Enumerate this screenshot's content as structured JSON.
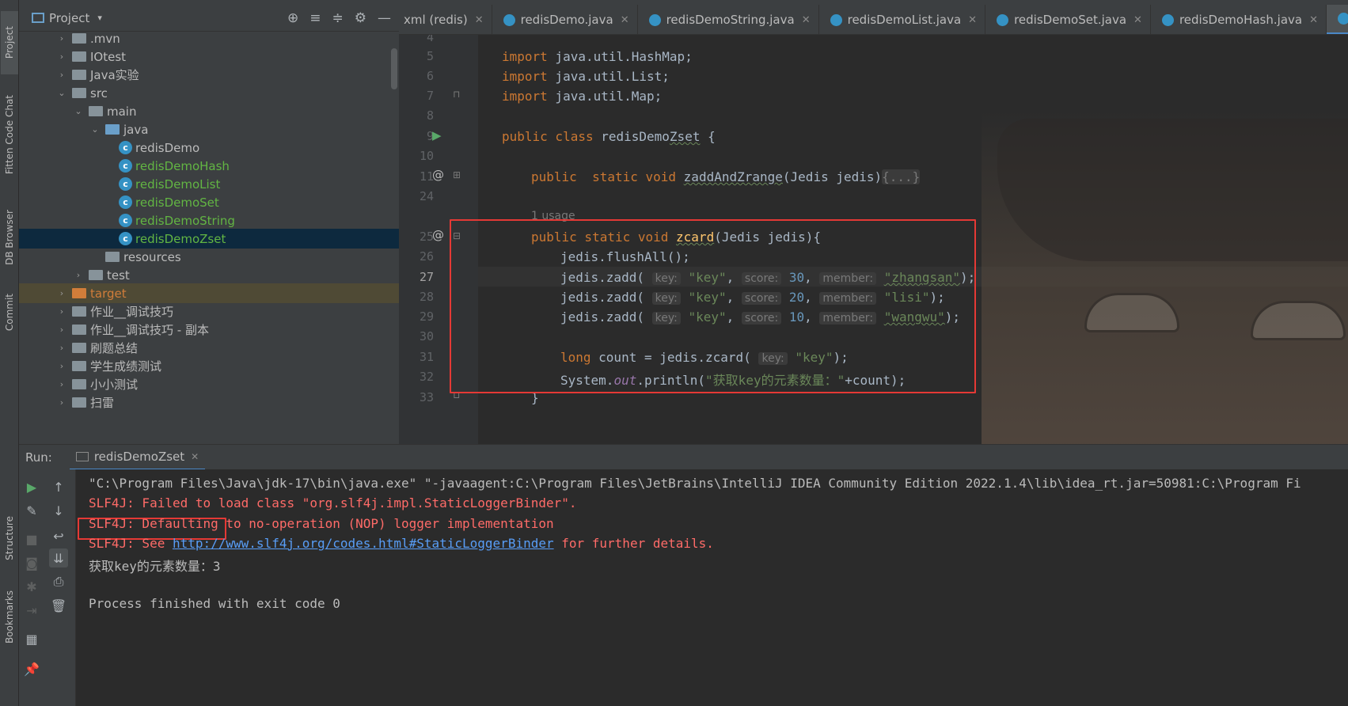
{
  "sidebar_left": {
    "tabs": [
      "Project",
      "Fitten Code Chat",
      "DB Browser",
      "Commit",
      "Structure",
      "Bookmarks"
    ]
  },
  "project_panel": {
    "title": "Project",
    "tree": [
      {
        "label": ".mvn",
        "depth": 3,
        "type": "folder",
        "arrow": "›"
      },
      {
        "label": "IOtest",
        "depth": 3,
        "type": "folder",
        "arrow": "›"
      },
      {
        "label": "Java实验",
        "depth": 3,
        "type": "folder",
        "arrow": "›"
      },
      {
        "label": "src",
        "depth": 3,
        "type": "folder",
        "arrow": "⌄"
      },
      {
        "label": "main",
        "depth": 4,
        "type": "folder",
        "arrow": "⌄"
      },
      {
        "label": "java",
        "depth": 5,
        "type": "folder-blue",
        "arrow": "⌄"
      },
      {
        "label": "redisDemo",
        "depth": 6,
        "type": "class"
      },
      {
        "label": "redisDemoHash",
        "depth": 6,
        "type": "class-green"
      },
      {
        "label": "redisDemoList",
        "depth": 6,
        "type": "class-green"
      },
      {
        "label": "redisDemoSet",
        "depth": 6,
        "type": "class-green"
      },
      {
        "label": "redisDemoString",
        "depth": 6,
        "type": "class-green"
      },
      {
        "label": "redisDemoZset",
        "depth": 6,
        "type": "class-green",
        "selected": true
      },
      {
        "label": "resources",
        "depth": 5,
        "type": "folder"
      },
      {
        "label": "test",
        "depth": 4,
        "type": "folder",
        "arrow": "›"
      },
      {
        "label": "target",
        "depth": 3,
        "type": "folder-orange",
        "arrow": "›",
        "target": true
      },
      {
        "label": "作业__调试技巧",
        "depth": 3,
        "type": "folder",
        "arrow": "›"
      },
      {
        "label": "作业__调试技巧 - 副本",
        "depth": 3,
        "type": "folder",
        "arrow": "›"
      },
      {
        "label": "刷题总结",
        "depth": 3,
        "type": "folder",
        "arrow": "›"
      },
      {
        "label": "学生成绩测试",
        "depth": 3,
        "type": "folder",
        "arrow": "›"
      },
      {
        "label": "小小测试",
        "depth": 3,
        "type": "folder",
        "arrow": "›"
      },
      {
        "label": "扫雷",
        "depth": 3,
        "type": "folder",
        "arrow": "›"
      }
    ]
  },
  "editor_tabs": [
    {
      "label": "xml (redis)",
      "icon": false
    },
    {
      "label": "redisDemo.java",
      "icon": true
    },
    {
      "label": "redisDemoString.java",
      "icon": true
    },
    {
      "label": "redisDemoList.java",
      "icon": true
    },
    {
      "label": "redisDemoSet.java",
      "icon": true
    },
    {
      "label": "redisDemoHash.java",
      "icon": true
    },
    {
      "label": "redisDe",
      "icon": true,
      "active": true
    }
  ],
  "editor": {
    "line_numbers": [
      "4",
      "5",
      "6",
      "7",
      "8",
      "9",
      "10",
      "11",
      "24",
      "",
      "25",
      "26",
      "27",
      "28",
      "29",
      "30",
      "31",
      "32",
      "33"
    ],
    "usage_hint": "1 usage",
    "code": {
      "l5": [
        "import",
        " java.util.HashMap;"
      ],
      "l6": [
        "import",
        " java.util.List;"
      ],
      "l7": [
        "import",
        " java.util.Map;"
      ],
      "l9": [
        "public class",
        " redisDemo",
        "Zset",
        " {"
      ],
      "l11": [
        "public  static void",
        " ",
        "zaddAndZrange",
        "(Jedis jedis)",
        "{...}"
      ],
      "l25": [
        "public static void",
        " ",
        "zcard",
        "(Jedis jedis){"
      ],
      "l26": "jedis.flushAll();",
      "l27": {
        "pre": "jedis.zadd(",
        "k": "key:",
        "kv": "\"key\"",
        "s": "score:",
        "sv": "30",
        "m": "member:",
        "mv": "\"zhangsan\"",
        "end": ");"
      },
      "l28": {
        "pre": "jedis.zadd(",
        "k": "key:",
        "kv": "\"key\"",
        "s": "score:",
        "sv": "20",
        "m": "member:",
        "mv": "\"lisi\"",
        "end": ");"
      },
      "l29": {
        "pre": "jedis.zadd(",
        "k": "key:",
        "kv": "\"key\"",
        "s": "score:",
        "sv": "10",
        "m": "member:",
        "mv": "\"wangwu\"",
        "end": ");"
      },
      "l31": {
        "kw": "long",
        "pre": " count = jedis.zcard(",
        "k": "key:",
        "kv": "\"key\"",
        "end": ");"
      },
      "l32": {
        "pre": "System.",
        "out": "out",
        "mid": ".println(",
        "str": "\"获取key的元素数量：\"",
        "end": "+count);"
      },
      "l33": "}"
    }
  },
  "run_panel": {
    "label": "Run:",
    "tab": "redisDemoZset",
    "console": [
      {
        "text": "\"C:\\Program Files\\Java\\jdk-17\\bin\\java.exe\" \"-javaagent:C:\\Program Files\\JetBrains\\IntelliJ IDEA Community Edition 2022.1.4\\lib\\idea_rt.jar=50981:C:\\Program Fi",
        "kind": "normal"
      },
      {
        "text": "SLF4J: Failed to load class \"org.slf4j.impl.StaticLoggerBinder\".",
        "kind": "err"
      },
      {
        "text": "SLF4J: Defaulting to no-operation (NOP) logger implementation",
        "kind": "err"
      },
      {
        "pre": "SLF4J: See ",
        "link": "http://www.slf4j.org/codes.html#StaticLoggerBinder",
        "post": " for further details.",
        "kind": "err-link"
      },
      {
        "text": "获取key的元素数量：3",
        "kind": "normal"
      },
      {
        "text": "",
        "kind": "normal"
      },
      {
        "text": "Process finished with exit code 0",
        "kind": "normal"
      }
    ]
  },
  "colors": {
    "accent": "#4a88c7",
    "highlight_box": "#e53935",
    "keyword": "#cc7832",
    "string": "#6a8759",
    "number": "#6897bb",
    "error_text": "#ff6b68"
  }
}
